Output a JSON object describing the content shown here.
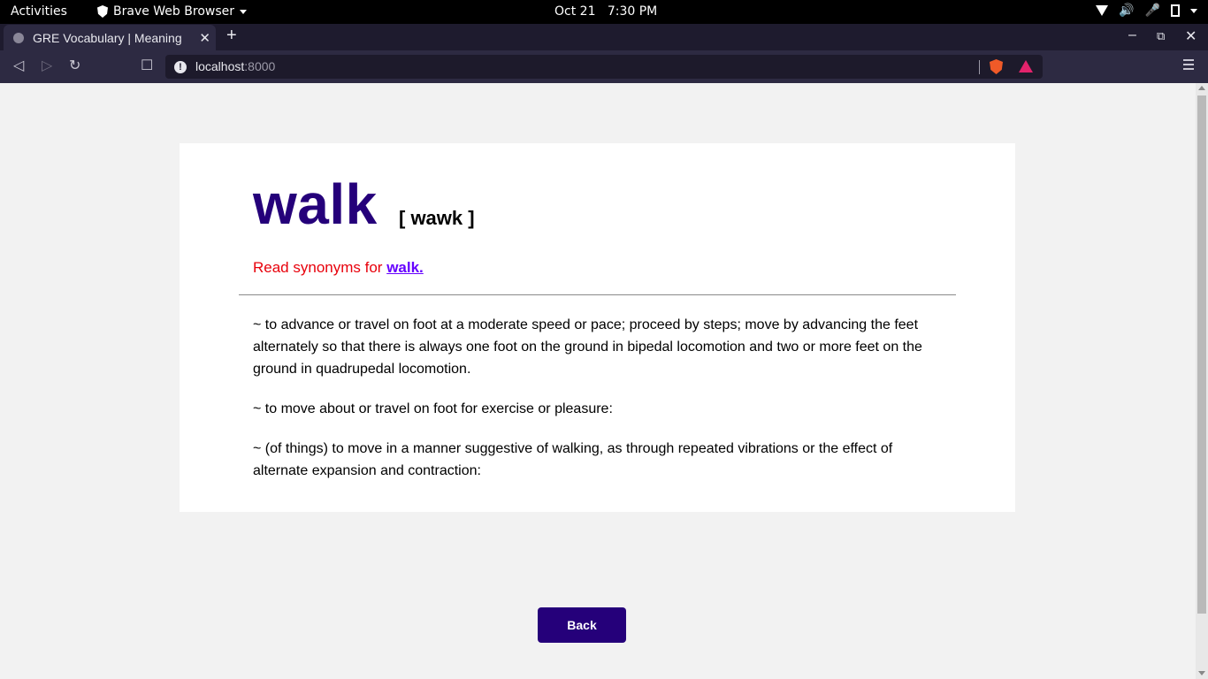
{
  "system": {
    "activities": "Activities",
    "app_name": "Brave Web Browser",
    "date": "Oct 21",
    "time": "7:30 PM"
  },
  "browser": {
    "tab_title": "GRE Vocabulary | Meaning",
    "url_host": "localhost",
    "url_port": ":8000"
  },
  "page": {
    "word": "walk",
    "pronunciation": "[ wawk ]",
    "synonyms_prefix": "Read synonyms for ",
    "synonyms_link": "walk.",
    "definitions": [
      "~ to advance or travel on foot at a moderate speed or pace; proceed by steps; move by advancing the feet alternately so that there is always one foot on the ground in bipedal locomotion and two or more feet on the ground in quadrupedal locomotion.",
      "~ to move about or travel on foot for exercise or pleasure:",
      "~ (of things) to move in a manner suggestive of walking, as through repeated vibrations or the effect of alternate expansion and contraction:"
    ],
    "back_label": "Back"
  },
  "colors": {
    "word": "#25007a",
    "synonym_text": "#e8000b",
    "synonym_link": "#6600ff",
    "button": "#25007a"
  }
}
